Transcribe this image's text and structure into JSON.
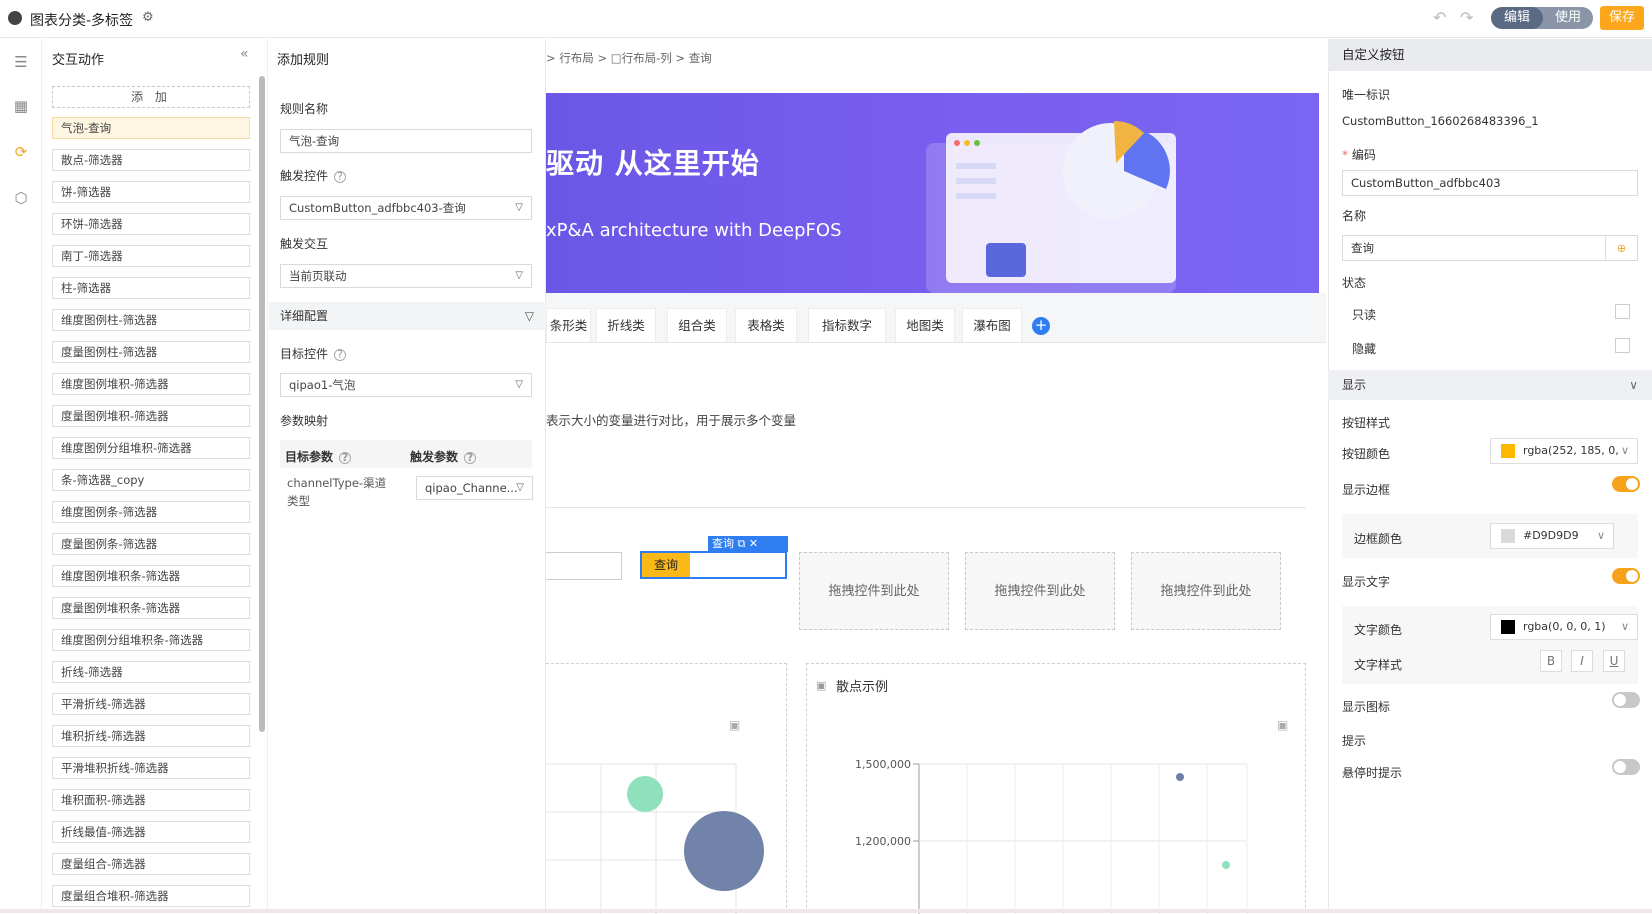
{
  "app": {
    "title": "图表分类-多标签"
  },
  "toolbar": {
    "edit_label": "编辑",
    "use_label": "使用",
    "save_label": "保存"
  },
  "interaction_panel": {
    "title": "交互动作",
    "add_label": "添 加",
    "items": [
      "气泡-查询",
      "散点-筛选器",
      "饼-筛选器",
      "环饼-筛选器",
      "南丁-筛选器",
      "柱-筛选器",
      "维度图例柱-筛选器",
      "度量图例柱-筛选器",
      "维度图例堆积-筛选器",
      "度量图例堆积-筛选器",
      "维度图例分组堆积-筛选器",
      "条-筛选器_copy",
      "维度图例条-筛选器",
      "度量图例条-筛选器",
      "维度图例堆积条-筛选器",
      "度量图例堆积条-筛选器",
      "维度图例分组堆积条-筛选器",
      "折线-筛选器",
      "平滑折线-筛选器",
      "堆积折线-筛选器",
      "平滑堆积折线-筛选器",
      "堆积面积-筛选器",
      "折线最值-筛选器",
      "度量组合-筛选器",
      "度量组合堆积-筛选器"
    ]
  },
  "rule_panel": {
    "title": "添加规则",
    "rule_name_label": "规则名称",
    "rule_name_value": "气泡-查询",
    "trigger_control_label": "触发控件",
    "trigger_control_value": "CustomButton_adfbbc403-查询",
    "trigger_interaction_label": "触发交互",
    "trigger_interaction_value": "当前页联动",
    "detail_label": "详细配置",
    "target_control_label": "目标控件",
    "target_control_value": "qipao1-气泡",
    "param_mapping_label": "参数映射",
    "target_param_header": "目标参数",
    "trigger_param_header": "触发参数",
    "mapping_target": "channelType-渠道类型",
    "mapping_trigger": "qipao_Channe..."
  },
  "canvas": {
    "breadcrumb": [
      "行布局",
      "行布局-列",
      "查询"
    ],
    "banner_title": "驱动 从这里开始",
    "banner_subtitle": "xP&A architecture with DeepFOS",
    "tabs": [
      "条形类",
      "折线类",
      "组合类",
      "表格类",
      "指标数字",
      "地图类",
      "瀑布图"
    ],
    "description": "表示大小的变量进行对比，用于展示多个变量",
    "query_button": "查询",
    "query_tag": "查询",
    "drop_hint": "拖拽控件到此处",
    "scatter_title": "散点示例",
    "scatter_yticks": [
      "1,500,000",
      "1,200,000"
    ]
  },
  "props": {
    "title": "自定义按钮",
    "uid_label": "唯一标识",
    "uid_value": "CustomButton_1660268483396_1",
    "code_label": "编码",
    "code_value": "CustomButton_adfbbc403",
    "name_label": "名称",
    "name_value": "查询",
    "state_label": "状态",
    "readonly_label": "只读",
    "hidden_label": "隐藏",
    "display_section": "显示",
    "button_style_label": "按钮样式",
    "button_color_label": "按钮颜色",
    "button_color_value": "rgba(252, 185, 0,",
    "show_border_label": "显示边框",
    "border_color_label": "边框颜色",
    "border_color_value": "#D9D9D9",
    "show_text_label": "显示文字",
    "text_color_label": "文字颜色",
    "text_color_value": "rgba(0, 0, 0, 1)",
    "text_style_label": "文字样式",
    "show_icon_label": "显示图标",
    "tip_label": "提示",
    "hover_tip_label": "悬停时提示"
  },
  "colors": {
    "accent": "#fba61b",
    "primary": "#2e7ef2",
    "banner": "#6a57e6",
    "button_color": "#fcb900",
    "border_color": "#D9D9D9"
  }
}
